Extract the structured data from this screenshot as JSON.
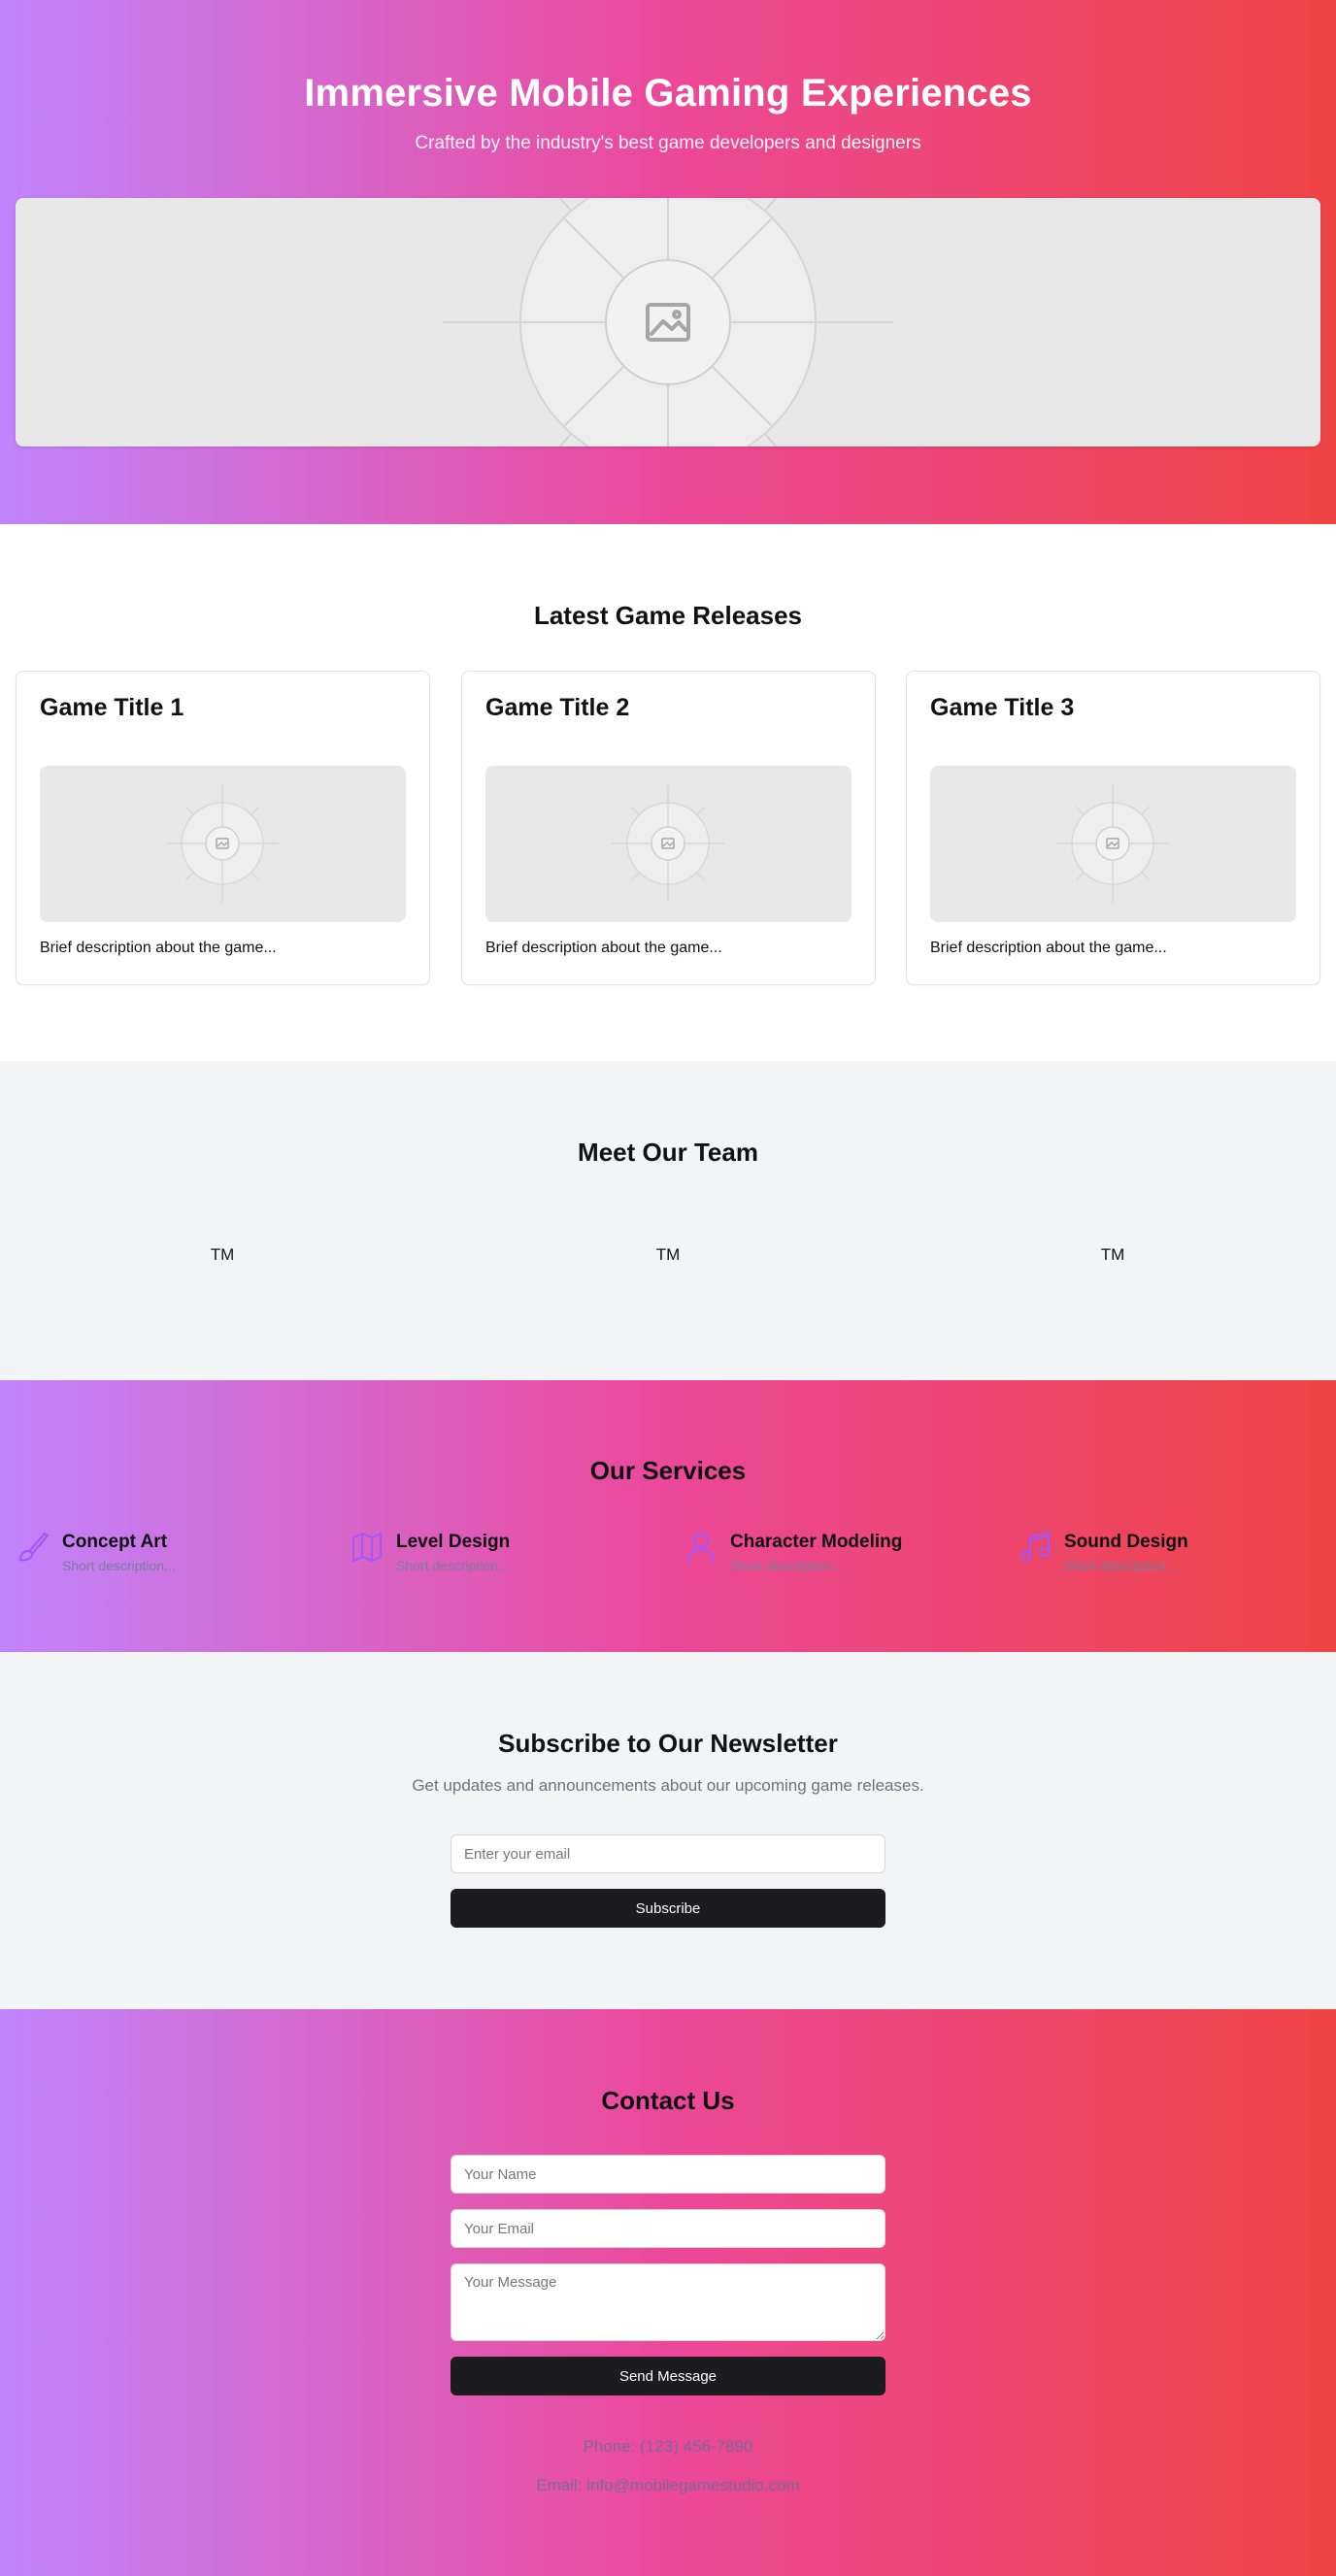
{
  "hero": {
    "title": "Immersive Mobile Gaming Experiences",
    "subtitle": "Crafted by the industry's best game developers and designers",
    "image_icon": "image-placeholder-icon"
  },
  "releases": {
    "title": "Latest Game Releases",
    "games": [
      {
        "title": "Game Title 1",
        "description": "Brief description about the game..."
      },
      {
        "title": "Game Title 2",
        "description": "Brief description about the game..."
      },
      {
        "title": "Game Title 3",
        "description": "Brief description about the game..."
      }
    ]
  },
  "team": {
    "title": "Meet Our Team",
    "members": [
      "TM",
      "TM",
      "TM"
    ]
  },
  "services": {
    "title": "Our Services",
    "items": [
      {
        "name": "Concept Art",
        "description": "Short description...",
        "icon": "brush-icon"
      },
      {
        "name": "Level Design",
        "description": "Short description...",
        "icon": "map-icon"
      },
      {
        "name": "Character Modeling",
        "description": "Short description...",
        "icon": "user-icon"
      },
      {
        "name": "Sound Design",
        "description": "Short description...",
        "icon": "music-icon"
      }
    ]
  },
  "newsletter": {
    "title": "Subscribe to Our Newsletter",
    "subtitle": "Get updates and announcements about our upcoming game releases.",
    "email_placeholder": "Enter your email",
    "button_label": "Subscribe"
  },
  "contact": {
    "title": "Contact Us",
    "name_placeholder": "Your Name",
    "email_placeholder": "Your Email",
    "message_placeholder": "Your Message",
    "button_label": "Send Message",
    "phone": "Phone: (123) 456-7890",
    "email": "Email: info@mobilegamestudio.com"
  },
  "colors": {
    "gradient_start": "#c084fc",
    "gradient_mid": "#ec4899",
    "gradient_end": "#ef4444",
    "icon_accent": "#a855f7",
    "button_dark": "#1c1c1e",
    "section_gray": "#f3f4f6"
  }
}
